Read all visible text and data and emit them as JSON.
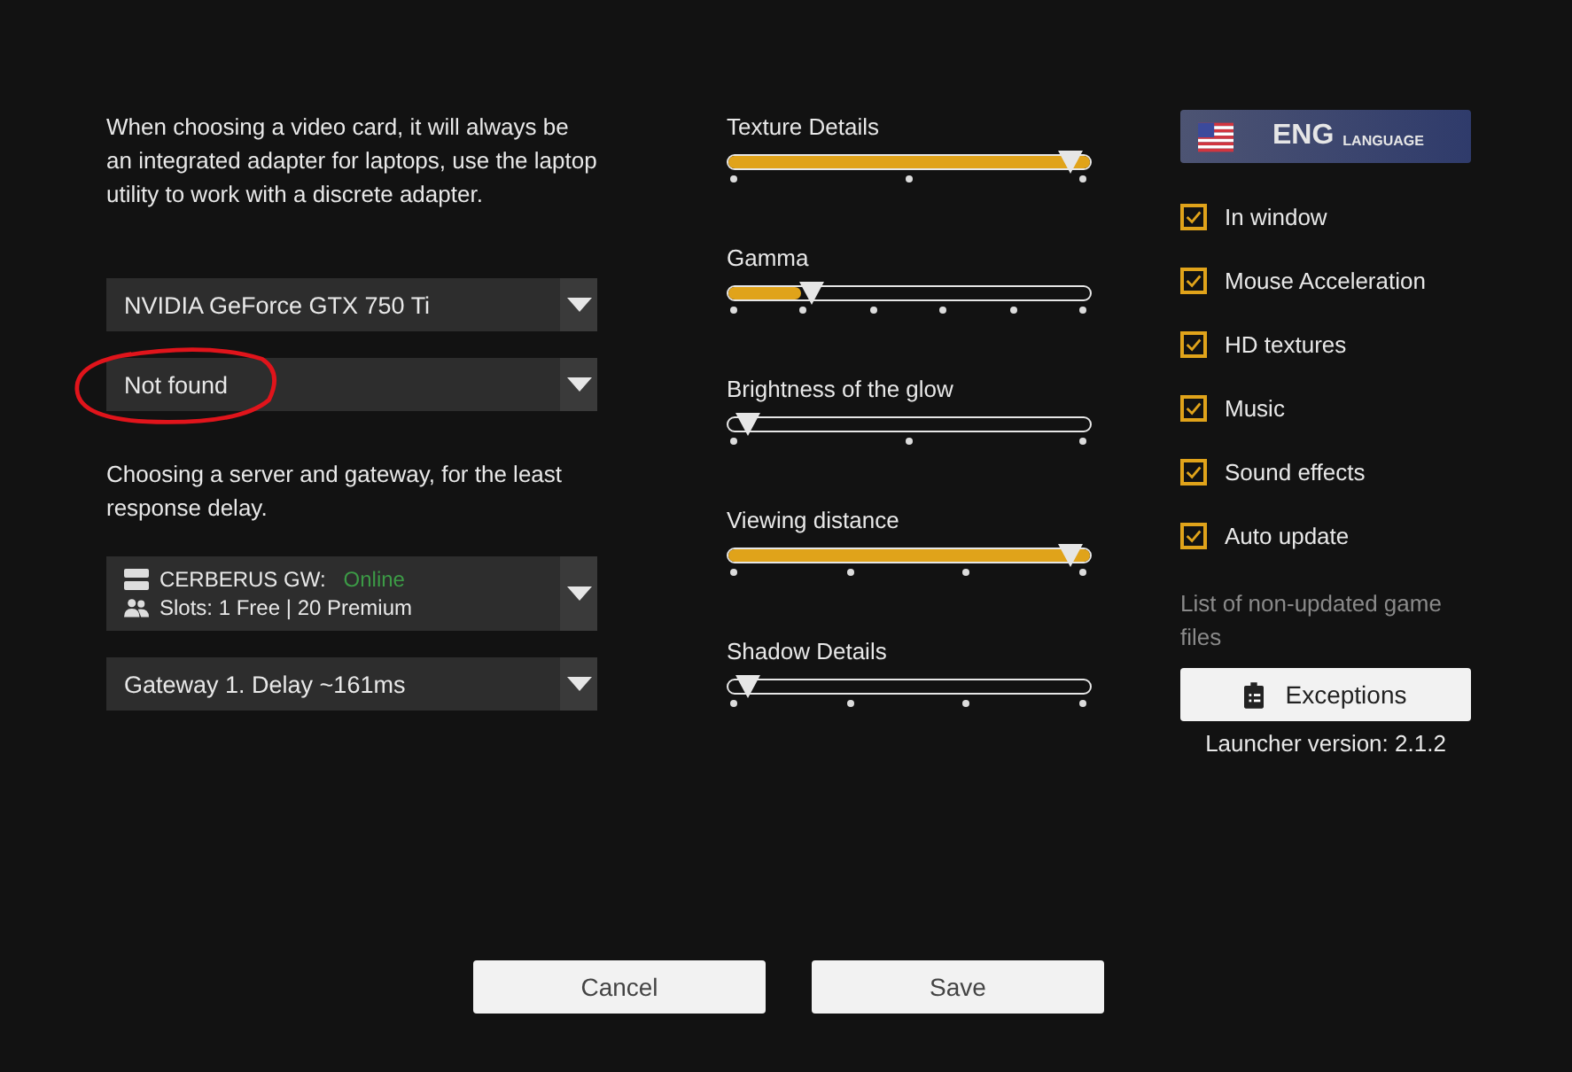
{
  "left": {
    "intro": "When choosing a video card, it will always be an integrated adapter for laptops, use the laptop utility to work with a discrete adapter.",
    "adapters": [
      {
        "kind": "select",
        "value": "NVIDIA GeForce GTX 750 Ti",
        "circled": false
      },
      {
        "kind": "select",
        "value": "Not found",
        "circled": true
      }
    ],
    "server_note": "Choosing a server and gateway, for the least response delay.",
    "servers": [
      {
        "kind": "server",
        "name": "CERBERUS GW:",
        "status": "Online",
        "color": "#3c9a46",
        "slots": "Slots: 1 Free | 20 Premium",
        "circled": false
      },
      {
        "kind": "select",
        "value": "Gateway 1. Delay ~161ms",
        "circled": false
      }
    ]
  },
  "sliders": [
    {
      "label": "Texture Details",
      "level": 1,
      "stops": [
        {
          "kind": "dot"
        },
        {
          "kind": "dot"
        },
        {
          "kind": "dot"
        }
      ]
    },
    {
      "label": "Gamma",
      "level": 0.2,
      "stops": [
        {
          "kind": "dot"
        },
        {
          "kind": "dot"
        },
        {
          "kind": "dot"
        },
        {
          "kind": "dot"
        },
        {
          "kind": "dot"
        },
        {
          "kind": "dot"
        }
      ]
    },
    {
      "label": "Brightness of the glow",
      "level": 0,
      "stops": [
        {
          "kind": "dot"
        },
        {
          "kind": "dot"
        },
        {
          "kind": "dot"
        }
      ]
    },
    {
      "label": "Viewing distance",
      "level": 1,
      "stops": [
        {
          "kind": "dot"
        },
        {
          "kind": "dot"
        },
        {
          "kind": "dot"
        },
        {
          "kind": "dot"
        }
      ]
    },
    {
      "label": "Shadow Details",
      "level": 0,
      "stops": [
        {
          "kind": "dot"
        },
        {
          "kind": "dot"
        },
        {
          "kind": "dot"
        },
        {
          "kind": "dot"
        }
      ]
    }
  ],
  "language": {
    "code": "ENG",
    "caption": "LANGUAGE"
  },
  "options": [
    {
      "label": "In window",
      "checked": true
    },
    {
      "label": "Mouse Acceleration",
      "checked": true
    },
    {
      "label": "HD textures",
      "checked": true
    },
    {
      "label": "Music",
      "checked": true
    },
    {
      "label": "Sound effects",
      "checked": true
    },
    {
      "label": "Auto update",
      "checked": true
    }
  ],
  "files_note": "List of non-updated game files",
  "exceptions_button": "Exceptions",
  "version": "Launcher version: 2.1.2",
  "buttons": [
    "Cancel",
    "Save"
  ]
}
